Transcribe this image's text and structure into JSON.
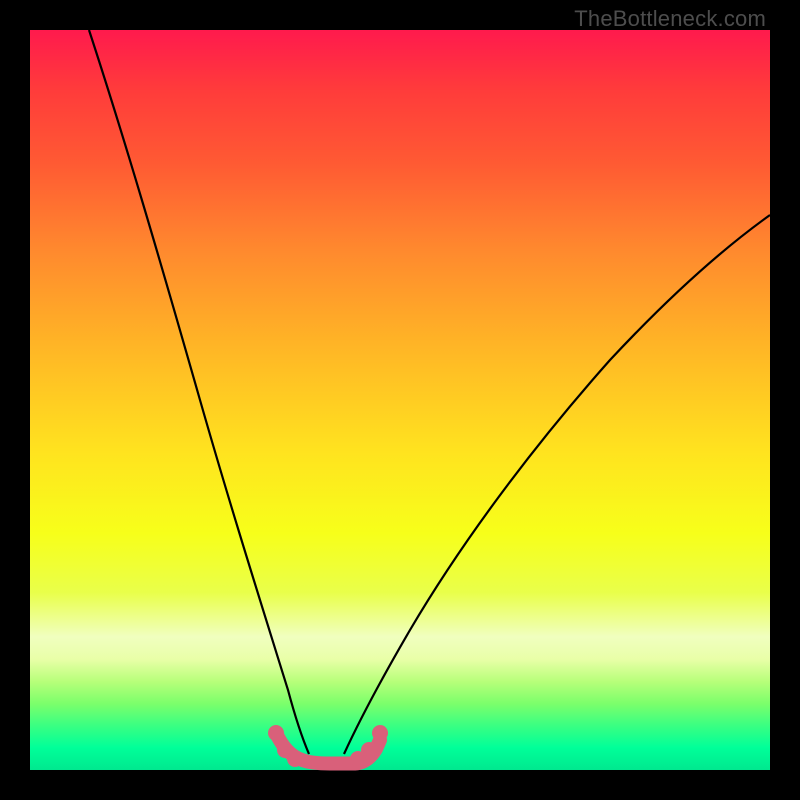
{
  "attribution": "TheBottleneck.com",
  "chart_data": {
    "type": "line",
    "title": "",
    "xlabel": "",
    "ylabel": "",
    "xlim": [
      0,
      100
    ],
    "ylim": [
      0,
      100
    ],
    "series": [
      {
        "name": "left-curve",
        "x": [
          8,
          12,
          16,
          20,
          24,
          28,
          31,
          33,
          34.5,
          35.8
        ],
        "y": [
          100,
          84,
          68,
          53,
          39,
          26,
          15,
          8,
          4,
          2.2
        ]
      },
      {
        "name": "right-curve",
        "x": [
          44.5,
          46,
          48,
          52,
          58,
          66,
          76,
          88,
          100
        ],
        "y": [
          2.2,
          4,
          7,
          14,
          24,
          36,
          49,
          61,
          72
        ]
      },
      {
        "name": "bottom-band-centerline",
        "x": [
          33.2,
          34.5,
          36.2,
          38.5,
          41.5,
          43.8,
          45.5,
          46.8
        ],
        "y": [
          4.8,
          2.6,
          1.4,
          1.1,
          1.1,
          1.4,
          2.6,
          4.8
        ]
      }
    ],
    "bottom_band": {
      "color": "#d9607a",
      "thickness_px": 14,
      "dots": [
        {
          "x": 33.2,
          "y": 4.8
        },
        {
          "x": 34.5,
          "y": 2.6
        },
        {
          "x": 35.8,
          "y": 1.6
        },
        {
          "x": 44.2,
          "y": 1.6
        },
        {
          "x": 45.5,
          "y": 2.6
        },
        {
          "x": 46.8,
          "y": 4.8
        }
      ]
    },
    "gradient_stops": [
      {
        "pos": 0.0,
        "color": "#ff1a4d"
      },
      {
        "pos": 0.3,
        "color": "#ff8a2e"
      },
      {
        "pos": 0.57,
        "color": "#ffe31f"
      },
      {
        "pos": 0.82,
        "color": "#f0ffbf"
      },
      {
        "pos": 1.0,
        "color": "#00e88f"
      }
    ]
  }
}
